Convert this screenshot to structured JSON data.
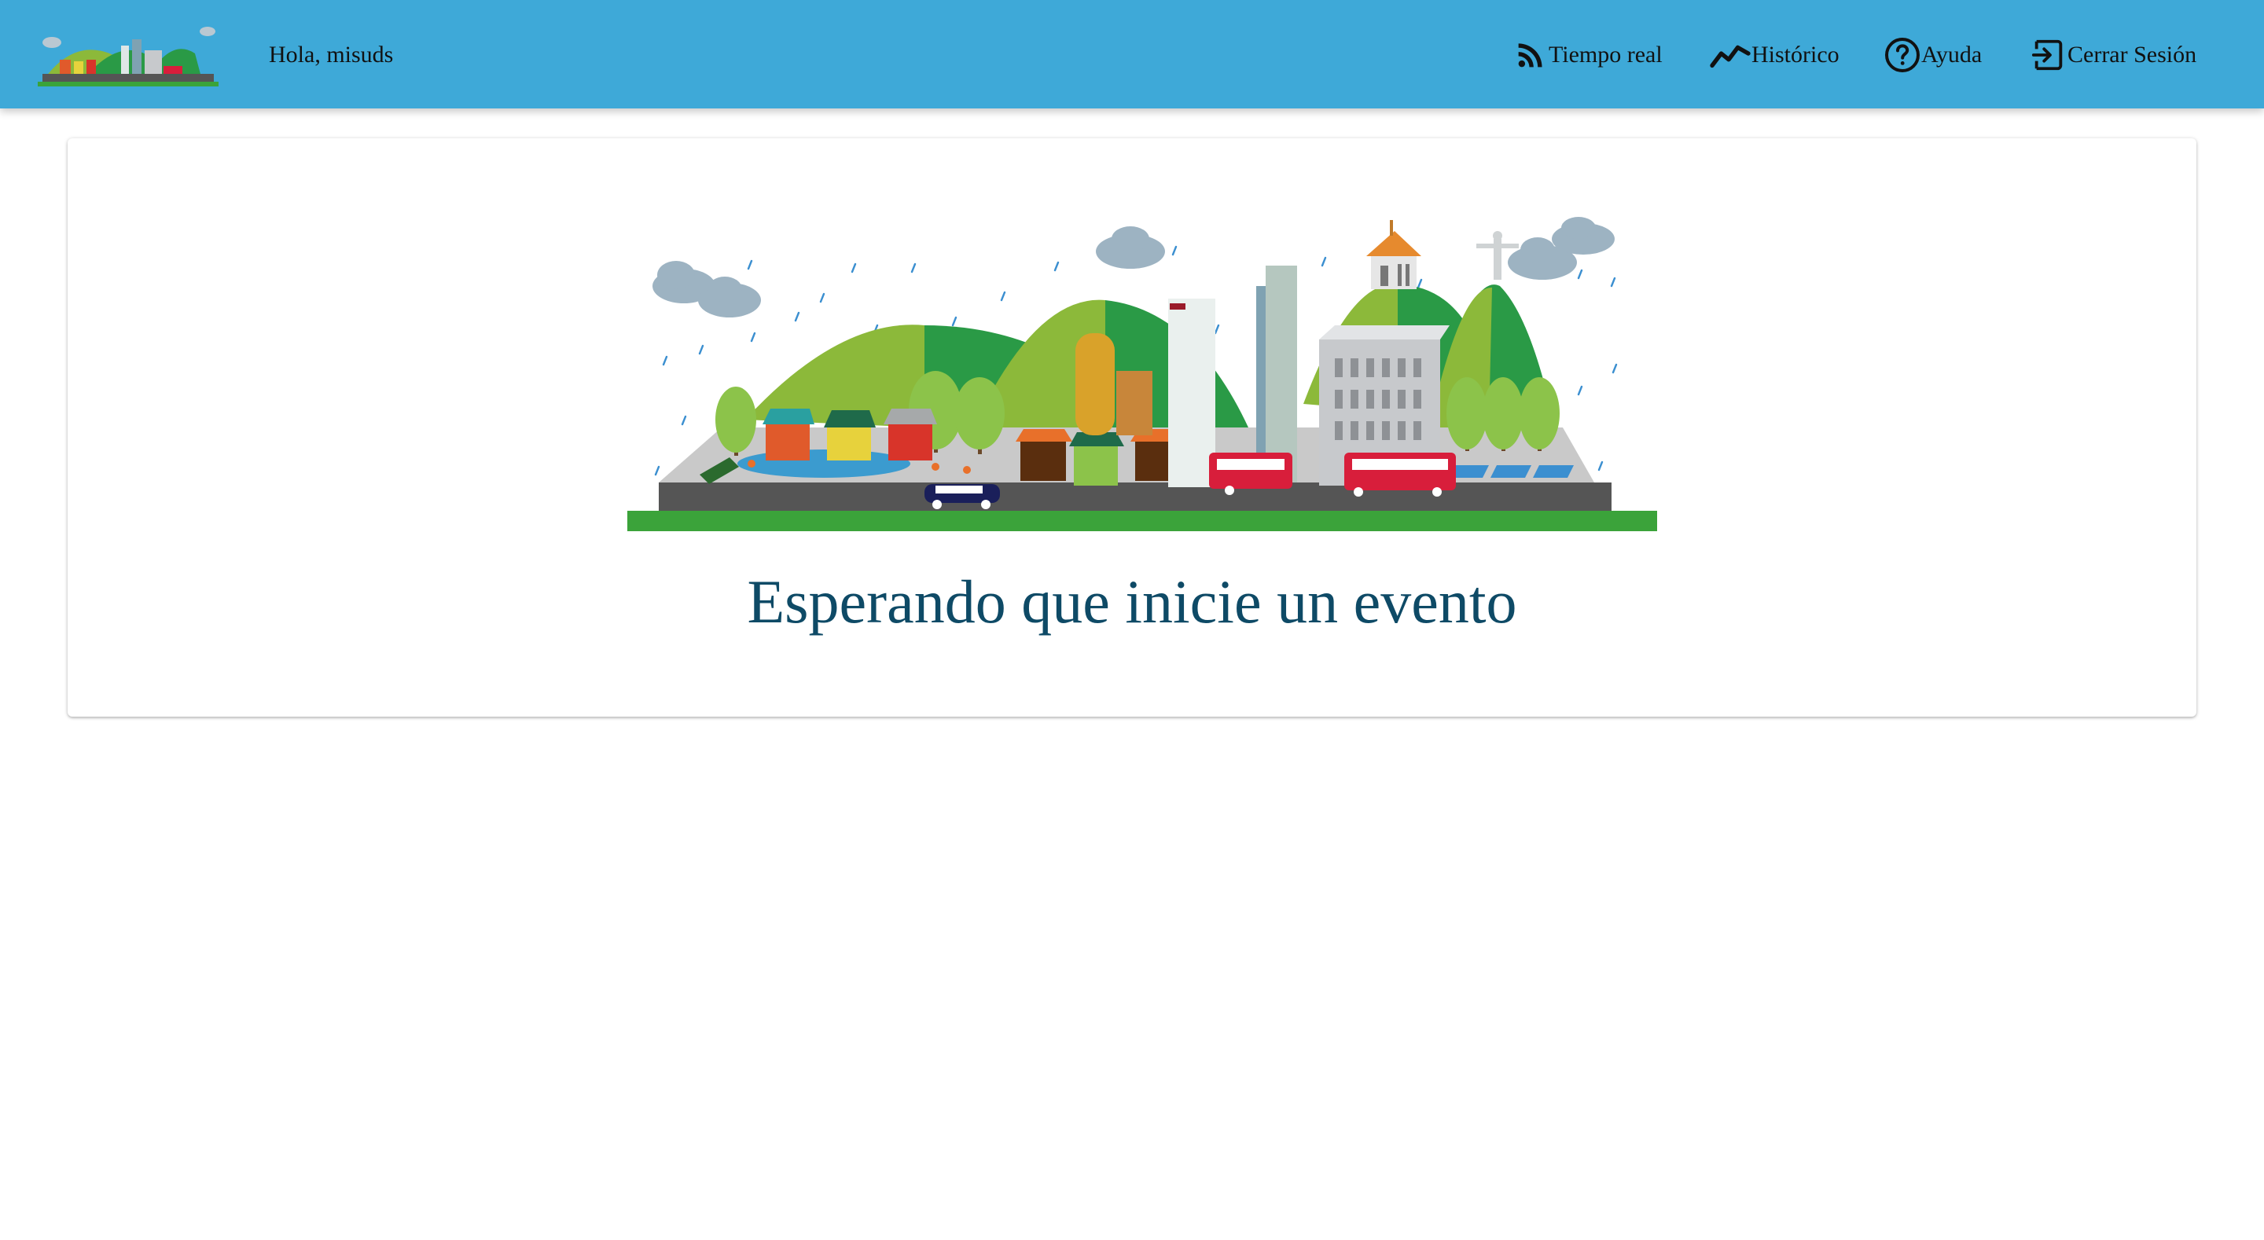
{
  "header": {
    "greeting": "Hola, misuds",
    "logo_icon": "city-logo-icon",
    "background_color": "#3ea9d8"
  },
  "nav": [
    {
      "label": "Tiempo real",
      "icon": "rss-feed-icon"
    },
    {
      "label": "Histórico",
      "icon": "trend-line-icon"
    },
    {
      "label": "Ayuda",
      "icon": "help-circle-icon"
    },
    {
      "label": "Cerrar Sesión",
      "icon": "logout-icon"
    }
  ],
  "main": {
    "illustration": "city-landscape-illustration",
    "message": "Esperando que inicie un evento",
    "message_color": "#0e4a66"
  }
}
